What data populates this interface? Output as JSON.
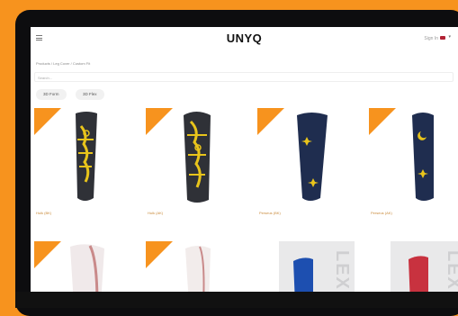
{
  "header": {
    "brand": "UNYQ",
    "signin": "Sign In",
    "menu_icon": "hamburger-icon",
    "flag_icon": "us-flag-icon",
    "chevron_icon": "chevron-down-icon"
  },
  "breadcrumb": "Products / Leg Cover / Custom Fit",
  "search": {
    "placeholder": "Search..."
  },
  "filters": [
    "3D Form",
    "3D Flex"
  ],
  "badge_label": "New",
  "products": [
    {
      "label": "Hulk (BK)"
    },
    {
      "label": "Hulk (AK)"
    },
    {
      "label": "Perseus (BK)"
    },
    {
      "label": "Perseus (AK)"
    }
  ],
  "colors": {
    "accent": "#f7931e",
    "dark_cover": "#2f3137",
    "gold": "#e8c41b",
    "navy": "#1f2d4f"
  }
}
